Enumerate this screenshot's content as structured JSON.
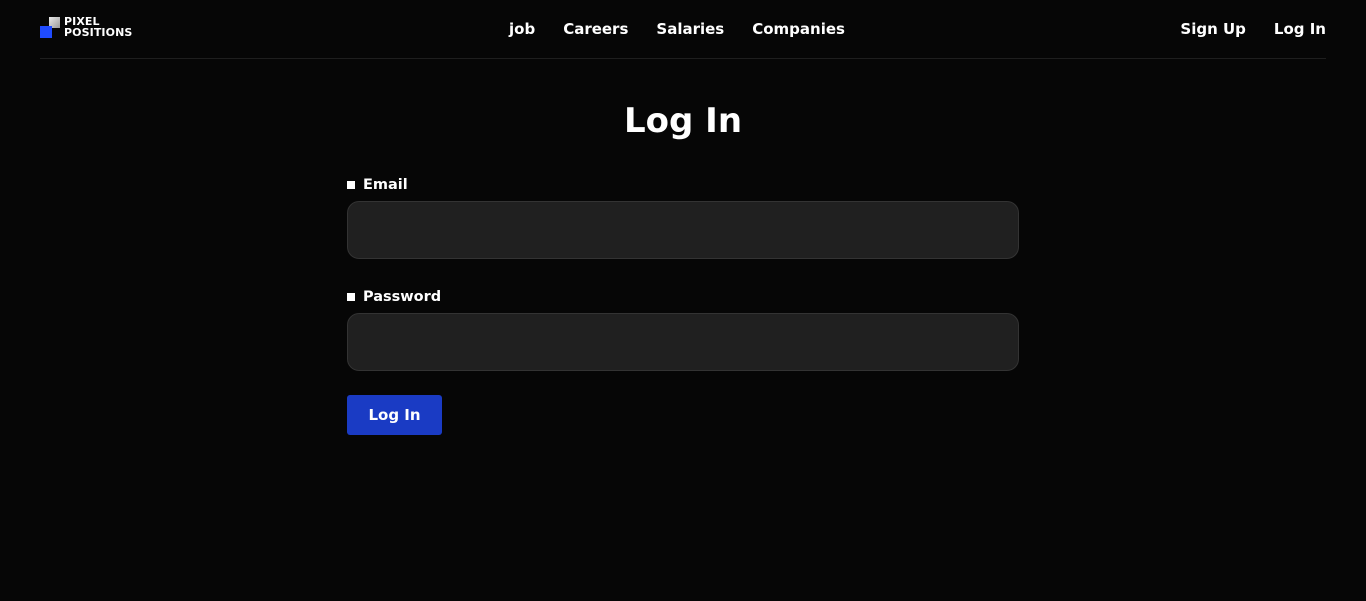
{
  "brand": {
    "line1": "PIXEL",
    "line2": "POSITIONS",
    "accent_color": "#1f4bff"
  },
  "nav": {
    "main": [
      {
        "label": "job"
      },
      {
        "label": "Careers"
      },
      {
        "label": "Salaries"
      },
      {
        "label": "Companies"
      }
    ],
    "auth": {
      "sign_up": "Sign Up",
      "log_in": "Log In"
    }
  },
  "page": {
    "title": "Log In"
  },
  "form": {
    "email": {
      "label": "Email",
      "value": ""
    },
    "password": {
      "label": "Password",
      "value": ""
    },
    "submit_label": "Log In",
    "submit_color": "#1a3bc4"
  }
}
